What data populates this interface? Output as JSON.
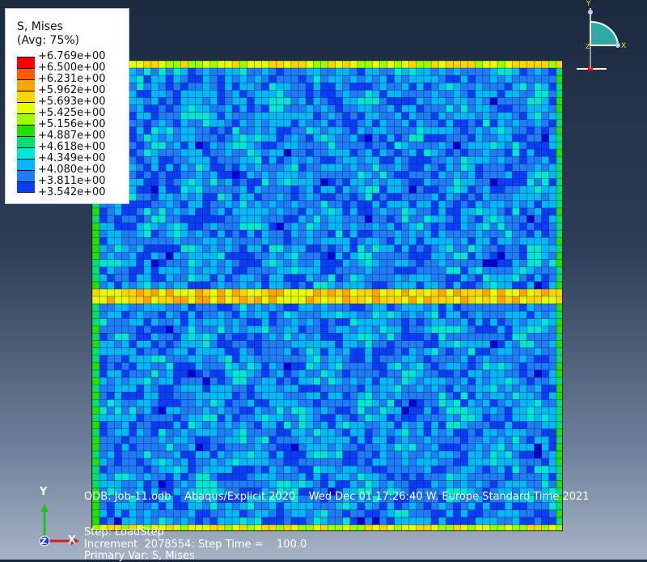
{
  "legend": {
    "title": "S, Mises",
    "subtitle": "(Avg: 75%)",
    "values": [
      "+6.769e+00",
      "+6.500e+00",
      "+6.231e+00",
      "+5.962e+00",
      "+5.693e+00",
      "+5.425e+00",
      "+5.156e+00",
      "+4.887e+00",
      "+4.618e+00",
      "+4.349e+00",
      "+4.080e+00",
      "+3.811e+00",
      "+3.542e+00"
    ],
    "colors": [
      "#ff0000",
      "#ff5a00",
      "#ffa500",
      "#ffd500",
      "#e6ff00",
      "#9aff00",
      "#22e000",
      "#00e070",
      "#00e6d6",
      "#00b8ff",
      "#1f7cff",
      "#0a3cff",
      "#0000d6"
    ]
  },
  "triad": {
    "y_label": "Y",
    "x_label": "X",
    "z_label": "Z"
  },
  "axes": {
    "y_label": "Y",
    "x_label": "X",
    "z_label": "Z"
  },
  "info": {
    "line1": "ODB: Job-11.odb    Abaqus/Explicit 2020    Wed Dec 01 17:26:40 W. Europe Standard Time 2021",
    "line2": "Step: LoadStep",
    "line3": "Increment  2078554: Step Time =    100.0",
    "line4": "Primary Var: S, Mises"
  },
  "mesh": {
    "base_color": "#1e6fd8",
    "band_color": "#ffb000",
    "line_color": "#0b2a1e"
  }
}
